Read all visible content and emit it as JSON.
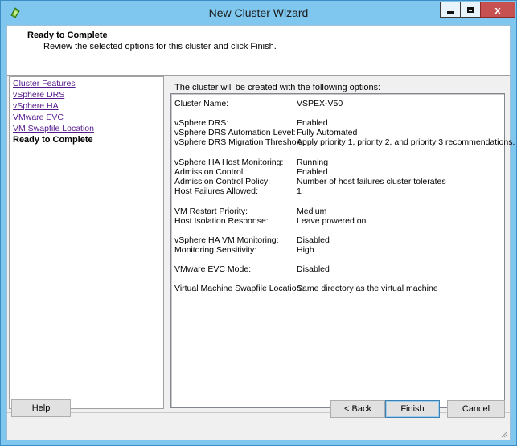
{
  "window": {
    "title": "New Cluster Wizard",
    "close_glyph": "x"
  },
  "header": {
    "title": "Ready to Complete",
    "subtitle": "Review the selected options for this cluster and click Finish."
  },
  "nav": {
    "items": [
      {
        "label": "Cluster Features",
        "state": "visited"
      },
      {
        "label": "vSphere DRS",
        "state": "visited"
      },
      {
        "label": "vSphere HA",
        "state": "visited"
      },
      {
        "label": "VMware EVC",
        "state": "visited"
      },
      {
        "label": "VM Swapfile Location",
        "state": "visited"
      },
      {
        "label": "Ready to Complete",
        "state": "current"
      }
    ]
  },
  "summary": {
    "intro": "The cluster will be created with the following options:",
    "rows": [
      {
        "label": "Cluster Name:",
        "value": "VSPEX-V50"
      },
      {
        "label": "vSphere DRS:",
        "value": "Enabled"
      },
      {
        "label": "vSphere DRS Automation Level:",
        "value": "Fully Automated"
      },
      {
        "label": "vSphere DRS Migration Threshold:",
        "value": "Apply priority 1, priority 2, and priority 3 recommendations."
      },
      {
        "label": "vSphere HA Host Monitoring:",
        "value": "Running"
      },
      {
        "label": "Admission Control:",
        "value": "Enabled"
      },
      {
        "label": "Admission Control Policy:",
        "value": "Number of host failures cluster tolerates"
      },
      {
        "label": "Host Failures Allowed:",
        "value": "1"
      },
      {
        "label": "VM Restart Priority:",
        "value": "Medium"
      },
      {
        "label": "Host Isolation Response:",
        "value": "Leave powered on"
      },
      {
        "label": "vSphere HA VM Monitoring:",
        "value": "Disabled"
      },
      {
        "label": "Monitoring Sensitivity:",
        "value": "High"
      },
      {
        "label": "VMware EVC Mode:",
        "value": "Disabled"
      },
      {
        "label": "Virtual Machine Swapfile Location:",
        "value": "Same directory as the virtual machine"
      }
    ]
  },
  "buttons": {
    "help": "Help",
    "back": "< Back",
    "finish": "Finish",
    "cancel": "Cancel"
  },
  "colors": {
    "titlebar": "#7fc7ee",
    "close_button": "#c75050",
    "link_visited": "#551a8b"
  }
}
